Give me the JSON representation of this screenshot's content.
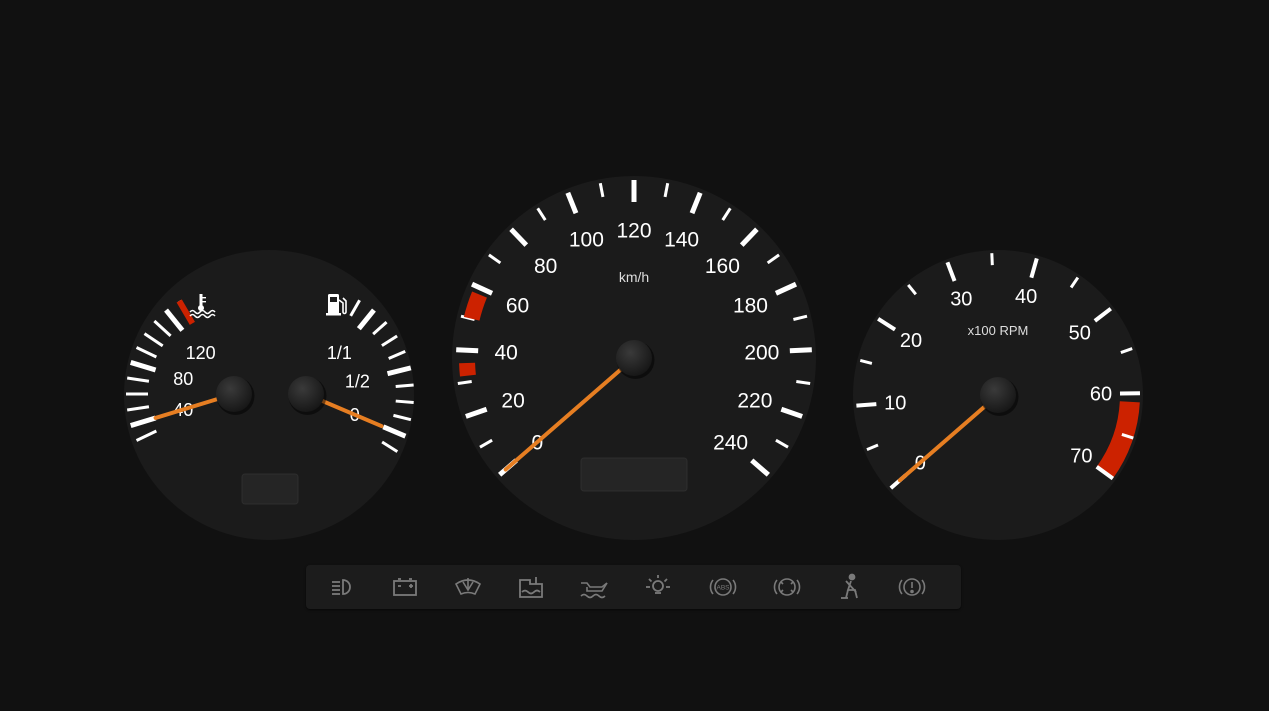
{
  "colors": {
    "background": "#111111",
    "gauge_face": "#1b1b1b",
    "tick": "#ffffff",
    "redline": "#cc2200",
    "needle": "#e67e22",
    "warning_icon": "#7a7a7a"
  },
  "combo_gauge": {
    "temperature": {
      "icon": "coolant-temperature-icon",
      "labels": [
        "40",
        "80",
        "120"
      ],
      "value_celsius": 40
    },
    "fuel": {
      "icon": "fuel-pump-icon",
      "labels": [
        "0",
        "1/2",
        "1/1"
      ],
      "value_fraction": 0.0
    }
  },
  "speedometer": {
    "unit": "km/h",
    "labels": [
      "0",
      "20",
      "40",
      "60",
      "80",
      "100",
      "120",
      "140",
      "160",
      "180",
      "200",
      "220",
      "240"
    ],
    "value_kmh": 0
  },
  "tachometer": {
    "unit": "x100 RPM",
    "labels": [
      "0",
      "10",
      "20",
      "30",
      "40",
      "50",
      "60",
      "70"
    ],
    "value_x100rpm": 0
  },
  "warning_lights": [
    "headlight-icon",
    "battery-icon",
    "washer-fluid-icon",
    "coolant-level-icon",
    "oil-pressure-icon",
    "bulb-failure-icon",
    "abs-icon",
    "brake-pad-icon",
    "seatbelt-icon",
    "brake-warning-icon"
  ]
}
